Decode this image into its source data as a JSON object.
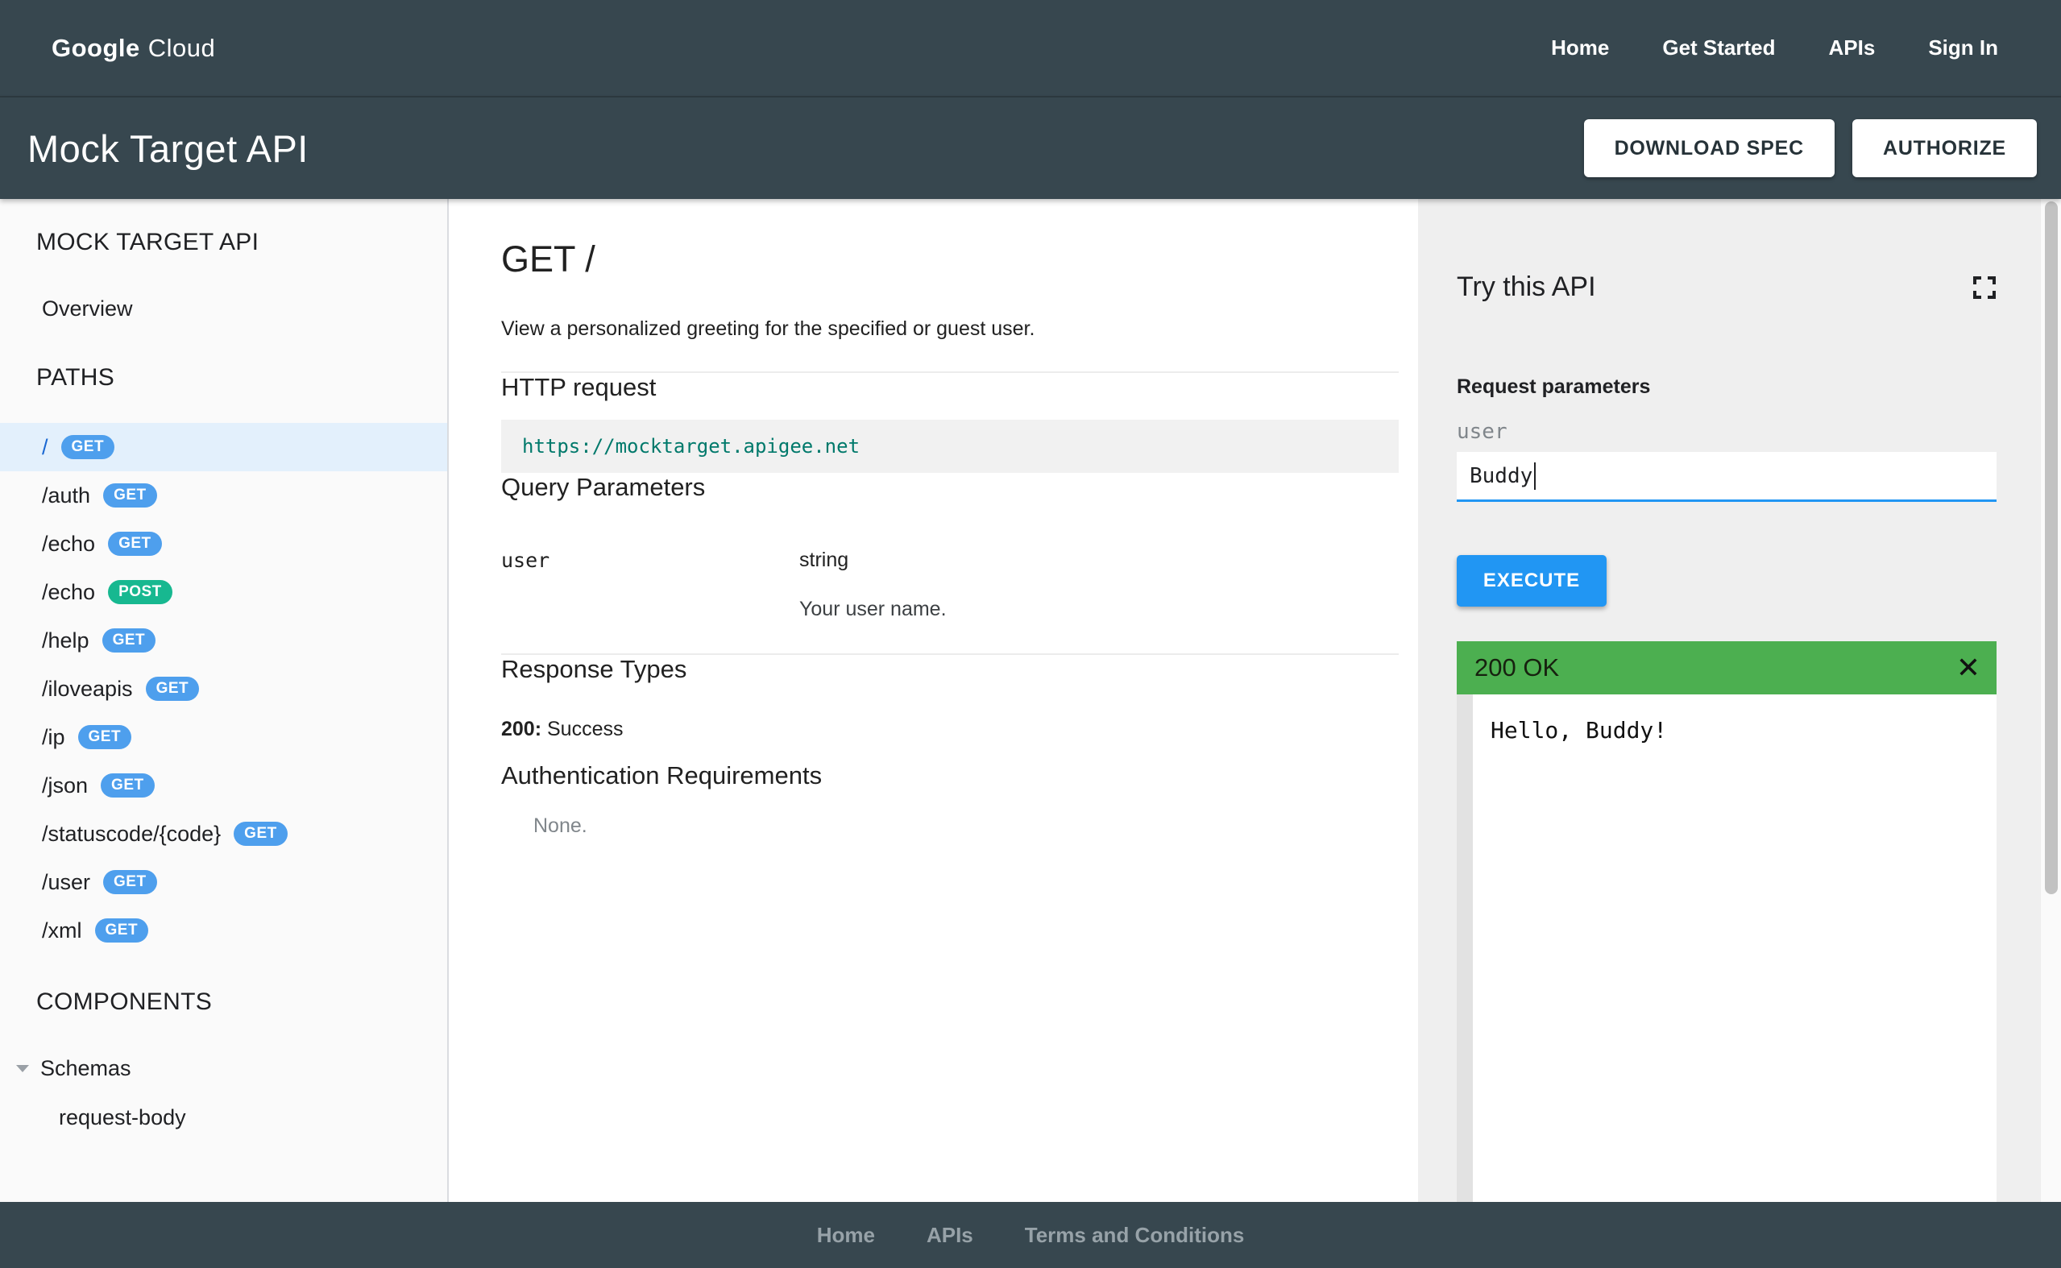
{
  "topnav": {
    "logo_google": "Google",
    "logo_cloud": "Cloud",
    "links": [
      "Home",
      "Get Started",
      "APIs",
      "Sign In"
    ]
  },
  "header": {
    "title": "Mock Target API",
    "download_spec_label": "DOWNLOAD SPEC",
    "authorize_label": "AUTHORIZE"
  },
  "sidebar": {
    "api_title": "MOCK TARGET API",
    "overview_label": "Overview",
    "paths_heading": "PATHS",
    "paths": [
      {
        "path": "/",
        "method": "GET"
      },
      {
        "path": "/auth",
        "method": "GET"
      },
      {
        "path": "/echo",
        "method": "GET"
      },
      {
        "path": "/echo",
        "method": "POST"
      },
      {
        "path": "/help",
        "method": "GET"
      },
      {
        "path": "/iloveapis",
        "method": "GET"
      },
      {
        "path": "/ip",
        "method": "GET"
      },
      {
        "path": "/json",
        "method": "GET"
      },
      {
        "path": "/statuscode/{code}",
        "method": "GET"
      },
      {
        "path": "/user",
        "method": "GET"
      },
      {
        "path": "/xml",
        "method": "GET"
      }
    ],
    "components_heading": "COMPONENTS",
    "schemas_label": "Schemas",
    "schema_items": [
      "request-body"
    ]
  },
  "main": {
    "title": "GET /",
    "description": "View a personalized greeting for the specified or guest user.",
    "http_request": {
      "heading": "HTTP request",
      "url": "https://mocktarget.apigee.net"
    },
    "query_parameters": {
      "heading": "Query Parameters",
      "rows": [
        {
          "name": "user",
          "type": "string",
          "description": "Your user name."
        }
      ]
    },
    "response_types": {
      "heading": "Response Types",
      "code": "200:",
      "text": " Success"
    },
    "auth": {
      "heading": "Authentication Requirements",
      "value": "None."
    }
  },
  "try_panel": {
    "title": "Try this API",
    "request_parameters_label": "Request parameters",
    "param_label": "user",
    "param_value": "Buddy",
    "execute_label": "EXECUTE",
    "response": {
      "status": "200 OK",
      "body": "Hello, Buddy!"
    }
  },
  "footer": {
    "links": [
      "Home",
      "APIs",
      "Terms and Conditions"
    ]
  },
  "icons": {
    "close": "✕"
  },
  "colors": {
    "header_dark": "#37474F",
    "accent_blue": "#2196F3",
    "get_badge": "#4E9FED",
    "post_badge": "#17B890",
    "success_green": "#4CAF50",
    "url_teal": "#00796B",
    "selected_row": "#E3F0FC",
    "selected_path": "#1967D2",
    "panel_grey": "#EFEFEF",
    "footer_link": "#97A2A8"
  }
}
